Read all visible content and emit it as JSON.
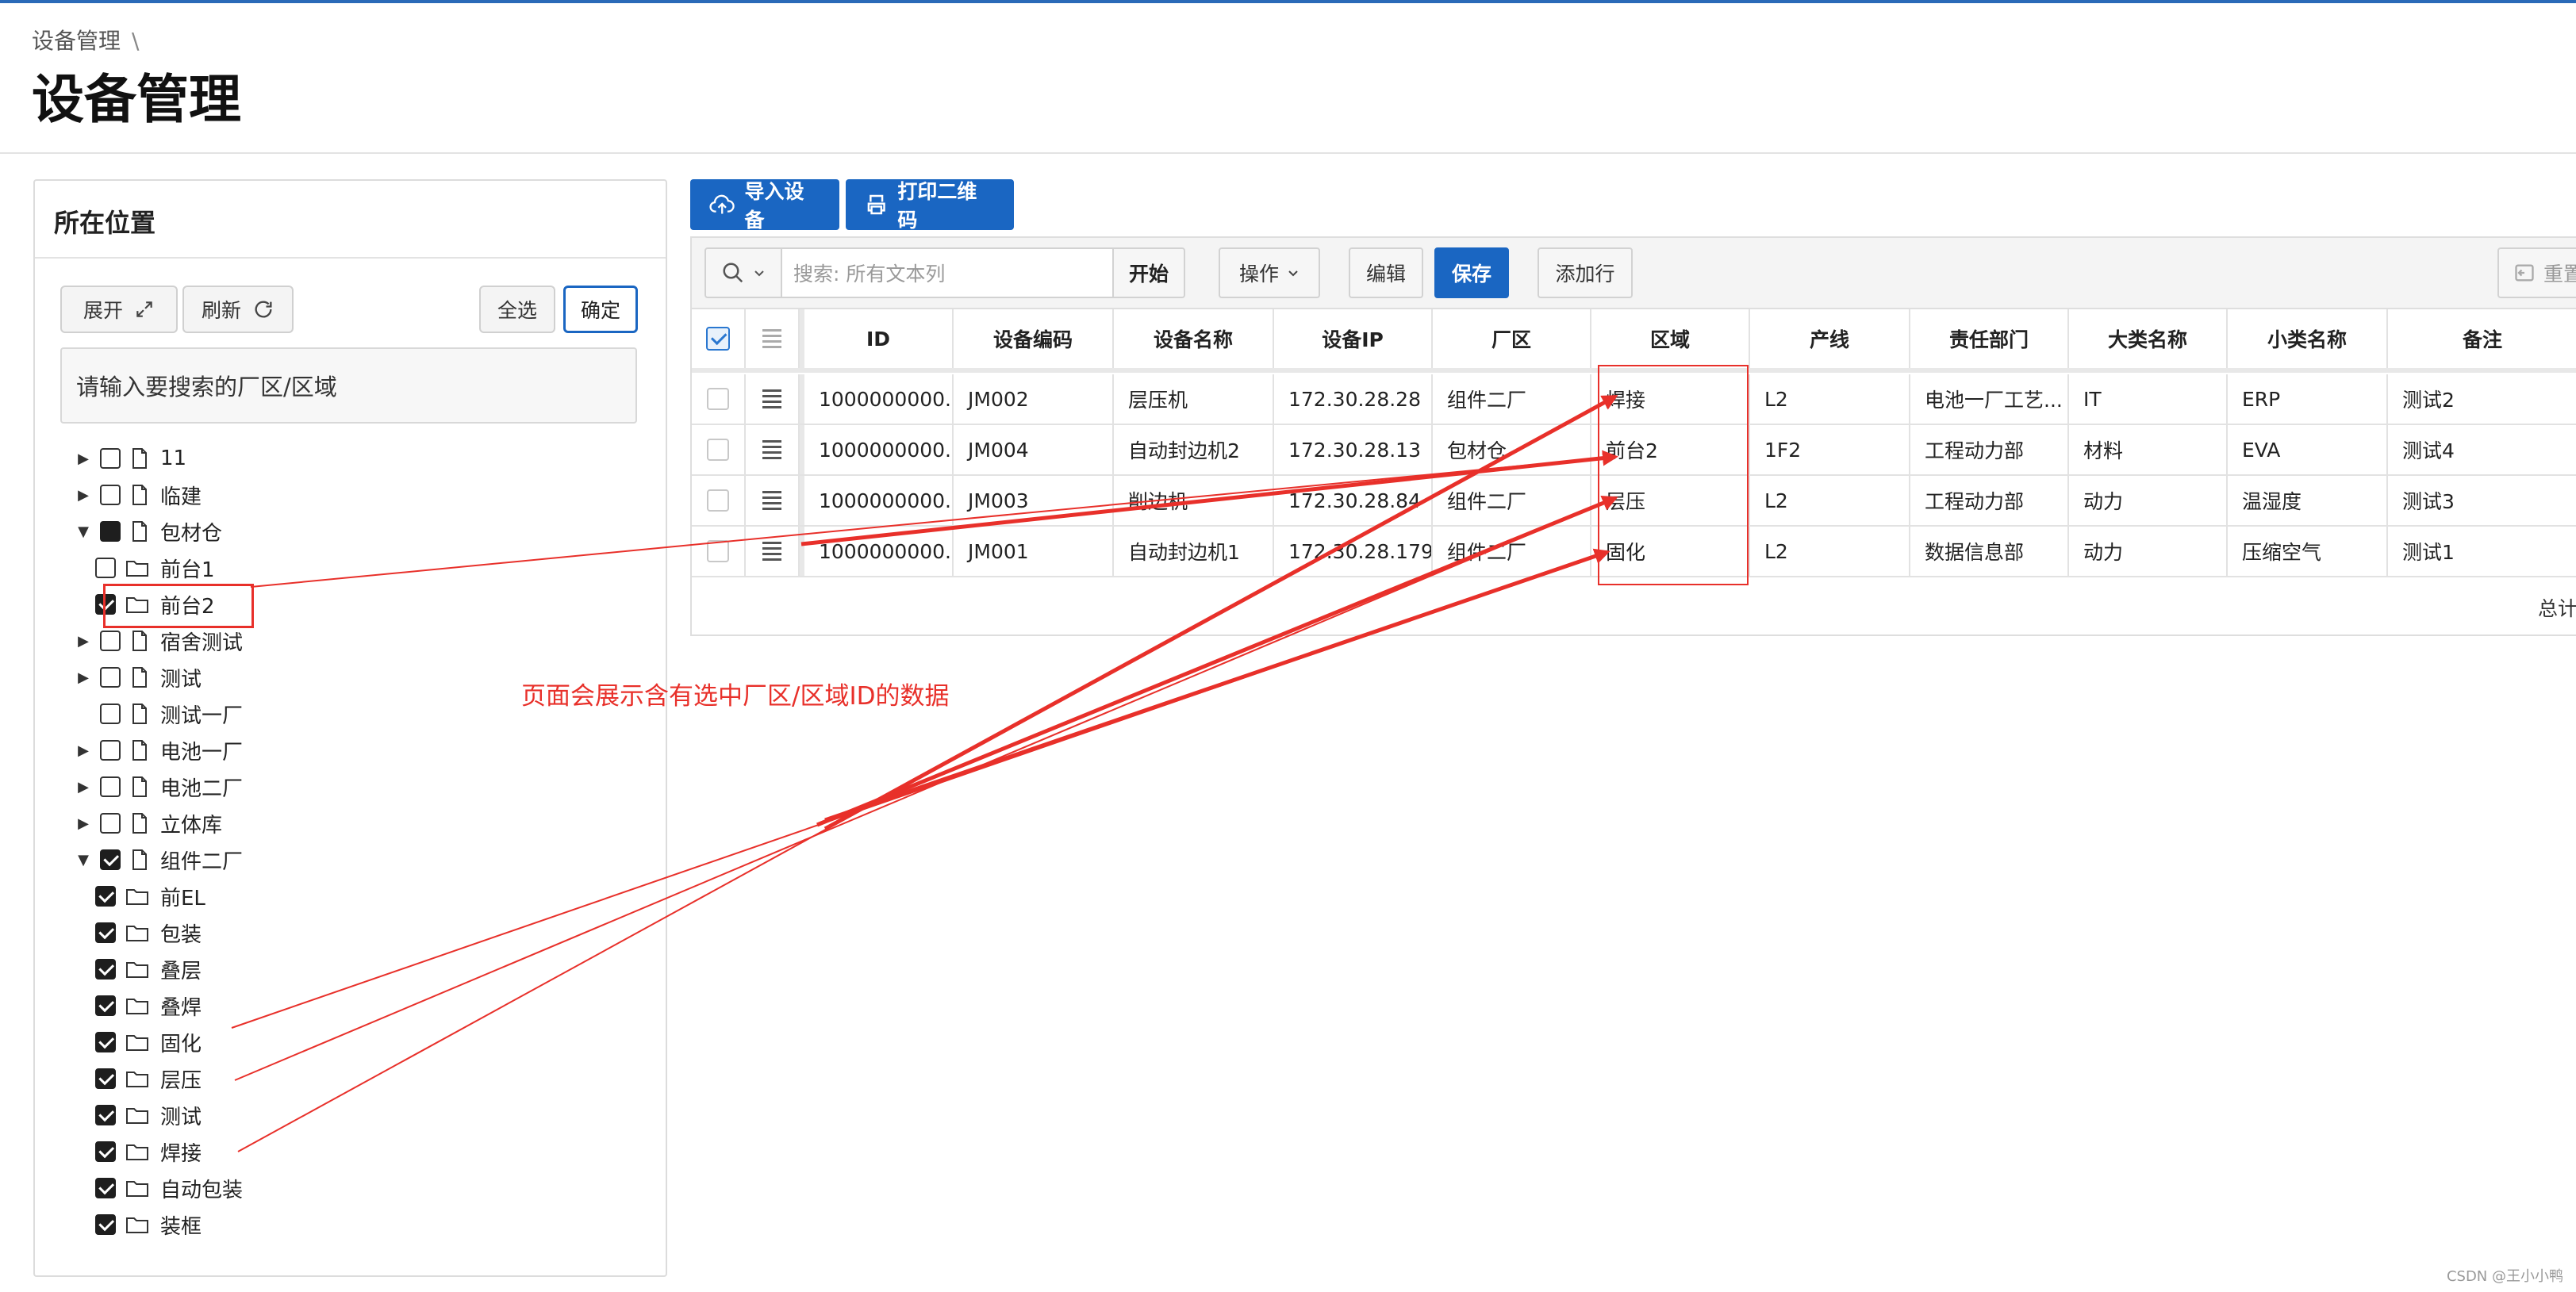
{
  "breadcrumb": {
    "item": "设备管理",
    "separator": "\\"
  },
  "page_title": "设备管理",
  "left_panel": {
    "title": "所在位置",
    "expand_label": "展开",
    "refresh_label": "刷新",
    "select_all_label": "全选",
    "confirm_label": "确定",
    "search_placeholder": "请输入要搜索的厂区/区域",
    "tree": [
      {
        "label": "11",
        "caret": "right",
        "state": "unchecked",
        "icon": "file-icon"
      },
      {
        "label": "临建",
        "caret": "right",
        "state": "unchecked",
        "icon": "file-icon"
      },
      {
        "label": "包材仓",
        "caret": "down",
        "state": "partial",
        "icon": "file-icon"
      },
      {
        "label": "前台1",
        "caret": "none",
        "state": "unchecked",
        "icon": "folder-icon"
      },
      {
        "label": "前台2",
        "caret": "none",
        "state": "checked",
        "icon": "folder-icon"
      },
      {
        "label": "宿舍测试",
        "caret": "right",
        "state": "unchecked",
        "icon": "file-icon"
      },
      {
        "label": "测试",
        "caret": "right",
        "state": "unchecked",
        "icon": "file-icon"
      },
      {
        "label": "测试一厂",
        "caret": "none",
        "state": "unchecked",
        "icon": "file-icon"
      },
      {
        "label": "电池一厂",
        "caret": "right",
        "state": "unchecked",
        "icon": "file-icon"
      },
      {
        "label": "电池二厂",
        "caret": "right",
        "state": "unchecked",
        "icon": "file-icon"
      },
      {
        "label": "立体库",
        "caret": "right",
        "state": "unchecked",
        "icon": "file-icon"
      },
      {
        "label": "组件二厂",
        "caret": "down",
        "state": "checked",
        "icon": "file-icon"
      },
      {
        "label": "前EL",
        "caret": "none",
        "state": "checked",
        "icon": "folder-icon"
      },
      {
        "label": "包装",
        "caret": "none",
        "state": "checked",
        "icon": "folder-icon"
      },
      {
        "label": "叠层",
        "caret": "none",
        "state": "checked",
        "icon": "folder-icon"
      },
      {
        "label": "叠焊",
        "caret": "none",
        "state": "checked",
        "icon": "folder-icon"
      },
      {
        "label": "固化",
        "caret": "none",
        "state": "checked",
        "icon": "folder-icon"
      },
      {
        "label": "层压",
        "caret": "none",
        "state": "checked",
        "icon": "folder-icon"
      },
      {
        "label": "测试",
        "caret": "none",
        "state": "checked",
        "icon": "folder-icon"
      },
      {
        "label": "焊接",
        "caret": "none",
        "state": "checked",
        "icon": "folder-icon"
      },
      {
        "label": "自动包装",
        "caret": "none",
        "state": "checked",
        "icon": "folder-icon"
      },
      {
        "label": "装框",
        "caret": "none",
        "state": "checked",
        "icon": "folder-icon"
      }
    ]
  },
  "toolbar": {
    "import_label": "导入设备",
    "print_label": "打印二维码"
  },
  "grid_toolbar": {
    "search_placeholder": "搜索: 所有文本列",
    "go_label": "开始",
    "actions_label": "操作",
    "edit_label": "编辑",
    "save_label": "保存",
    "add_row_label": "添加行",
    "reset_label": "重置"
  },
  "table": {
    "columns": [
      "ID",
      "设备编码",
      "设备名称",
      "设备IP",
      "厂区",
      "区域",
      "产线",
      "责任部门",
      "大类名称",
      "小类名称",
      "备注"
    ],
    "rows": [
      [
        "1000000000...",
        "JM002",
        "层压机",
        "172.30.28.28",
        "组件二厂",
        "焊接",
        "L2",
        "电池一厂工艺...",
        "IT",
        "ERP",
        "测试2"
      ],
      [
        "1000000000...",
        "JM004",
        "自动封边机2",
        "172.30.28.13",
        "包材仓",
        "前台2",
        "1F2",
        "工程动力部",
        "材料",
        "EVA",
        "测试4"
      ],
      [
        "1000000000...",
        "JM003",
        "削边机",
        "172.30.28.84",
        "组件二厂",
        "层压",
        "L2",
        "工程动力部",
        "动力",
        "温湿度",
        "测试3"
      ],
      [
        "1000000000...",
        "JM001",
        "自动封边机1",
        "172.30.28.179",
        "组件二厂",
        "固化",
        "L2",
        "数据信息部",
        "动力",
        "压缩空气",
        "测试1"
      ]
    ],
    "total_label": "总计"
  },
  "annotation_text": "页面会展示含有选中厂区/区域ID的数据",
  "watermark": "CSDN @王小小鸭",
  "colors": {
    "primary": "#1a66c2",
    "annotation": "#e8302a"
  }
}
